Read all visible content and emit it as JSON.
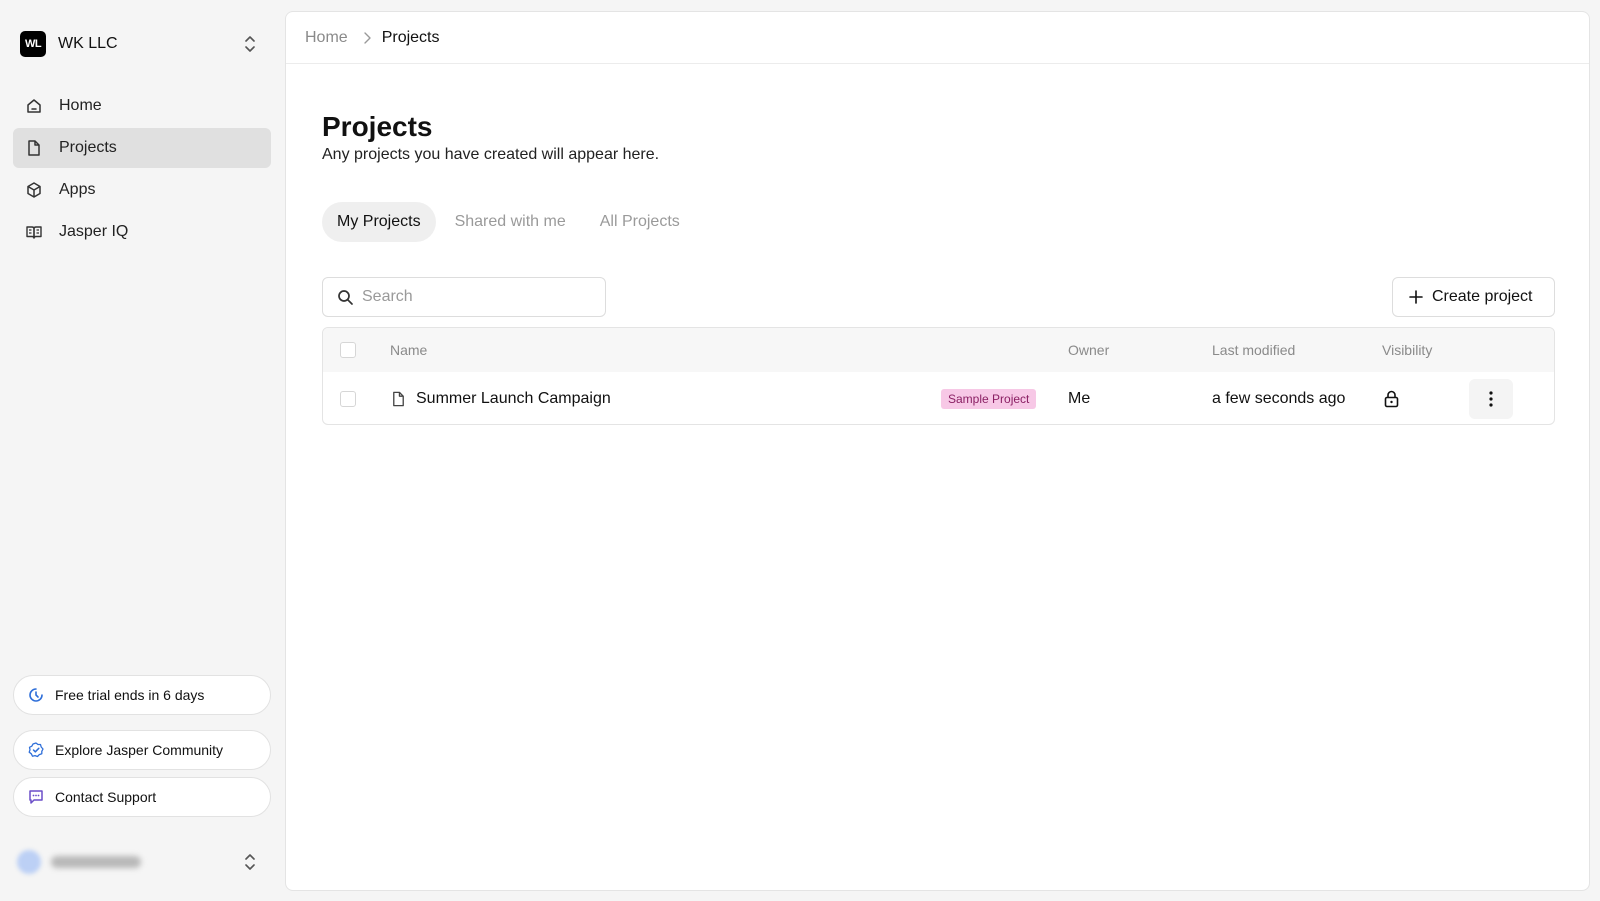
{
  "sidebar": {
    "org": {
      "logo_text": "WL",
      "name": "WK LLC"
    },
    "nav": [
      {
        "label": "Home",
        "icon": "home-icon"
      },
      {
        "label": "Projects",
        "icon": "file-icon",
        "active": true
      },
      {
        "label": "Apps",
        "icon": "cube-icon"
      },
      {
        "label": "Jasper IQ",
        "icon": "book-icon"
      }
    ],
    "trial_label": "Free trial ends in 6 days",
    "community_label": "Explore Jasper Community",
    "support_label": "Contact Support"
  },
  "breadcrumb": {
    "home": "Home",
    "current": "Projects"
  },
  "page": {
    "title": "Projects",
    "subtitle": "Any projects you have created will appear here."
  },
  "tabs": [
    {
      "label": "My Projects",
      "active": true
    },
    {
      "label": "Shared with me"
    },
    {
      "label": "All Projects"
    }
  ],
  "search": {
    "placeholder": "Search",
    "value": ""
  },
  "create_label": "Create project",
  "table": {
    "columns": {
      "name": "Name",
      "owner": "Owner",
      "modified": "Last modified",
      "visibility": "Visibility"
    },
    "rows": [
      {
        "name": "Summer Launch Campaign",
        "badge": "Sample Project",
        "owner": "Me",
        "modified": "a few seconds ago",
        "visibility": "private-lock-icon"
      }
    ]
  },
  "colors": {
    "active_nav_bg": "#e0e0e0",
    "badge_bg": "#f7c8e6",
    "badge_text": "#8a1f63",
    "accent_blue": "#2f6fd9"
  }
}
